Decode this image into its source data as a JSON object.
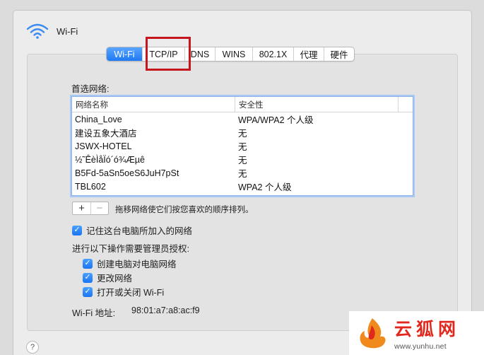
{
  "header": {
    "title": "Wi-Fi"
  },
  "tabs": [
    {
      "label": "Wi-Fi",
      "active": true
    },
    {
      "label": "TCP/IP",
      "active": false
    },
    {
      "label": "DNS",
      "active": false
    },
    {
      "label": "WINS",
      "active": false
    },
    {
      "label": "802.1X",
      "active": false
    },
    {
      "label": "代理",
      "active": false
    },
    {
      "label": "硬件",
      "active": false
    }
  ],
  "preferred": {
    "label": "首选网络:",
    "columns": [
      "网络名称",
      "安全性"
    ],
    "rows": [
      {
        "name": "China_Love",
        "security": "WPA/WPA2 个人级"
      },
      {
        "name": "建设五象大酒店",
        "security": "无"
      },
      {
        "name": "JSWX-HOTEL",
        "security": "无"
      },
      {
        "name": "½˜ÊèÌåÏó´ó¾Æµê",
        "security": "无"
      },
      {
        "name": "B5Fd-5aSn5oeS6JuH7pSt",
        "security": "无"
      },
      {
        "name": "TBL602",
        "security": "WPA2 个人级"
      }
    ],
    "add_label": "+",
    "remove_label": "−",
    "hint": "拖移网络使它们按您喜欢的顺序排列。"
  },
  "remember": {
    "label": "记住这台电脑所加入的网络",
    "checked": true
  },
  "admin": {
    "label": "进行以下操作需要管理员授权:",
    "options": [
      {
        "label": "创建电脑对电脑网络",
        "checked": true
      },
      {
        "label": "更改网络",
        "checked": true
      },
      {
        "label": "打开或关闭 Wi-Fi",
        "checked": true
      }
    ]
  },
  "address": {
    "label": "Wi-Fi 地址:",
    "value": "98:01:a7:a8:ac:f9"
  },
  "help": {
    "label": "?"
  },
  "watermark": {
    "brand": "云狐网",
    "url": "www.yunhu.net"
  },
  "colors": {
    "accent": "#1f79f5",
    "highlight": "#c4161c",
    "watermark": "#e0281c"
  },
  "icons": {
    "wifi": "wifi-icon",
    "check": "checkmark-icon"
  }
}
